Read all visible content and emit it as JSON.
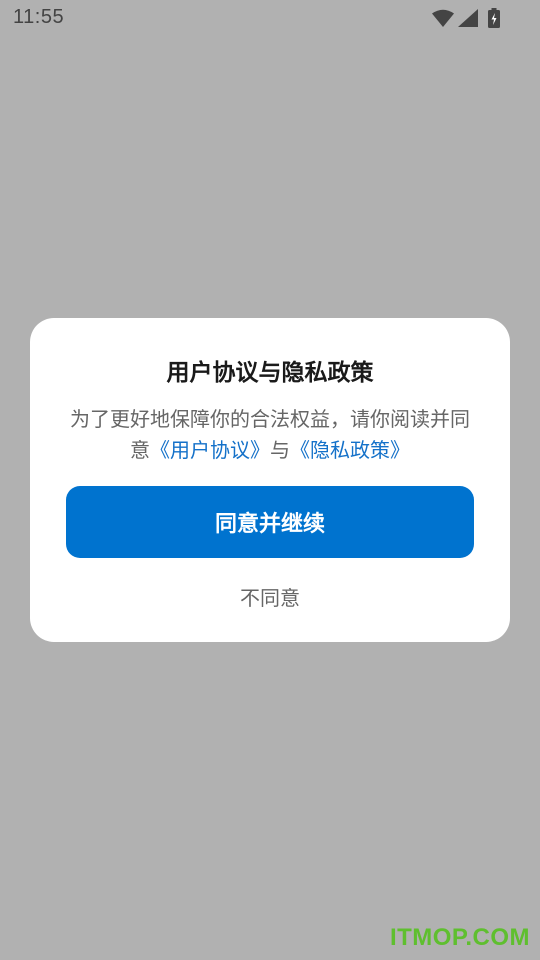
{
  "status_bar": {
    "time": "11:55",
    "icons": [
      "wifi-icon",
      "cell-signal-icon",
      "battery-charging-icon"
    ]
  },
  "dialog": {
    "title": "用户协议与隐私政策",
    "body_prefix": "为了更好地保障你的合法权益，请你阅读并同意",
    "user_agreement_link": "《用户协议》",
    "conjunction": "与",
    "privacy_policy_link": "《隐私政策》",
    "agree_button_label": "同意并继续",
    "disagree_button_label": "不同意"
  },
  "watermark": "ITMOP.COM",
  "colors": {
    "backdrop": "#b1b1b1",
    "dialog_background": "#ffffff",
    "primary_button": "#0073cf",
    "link": "#1471c9",
    "watermark": "#5fbf2f"
  }
}
